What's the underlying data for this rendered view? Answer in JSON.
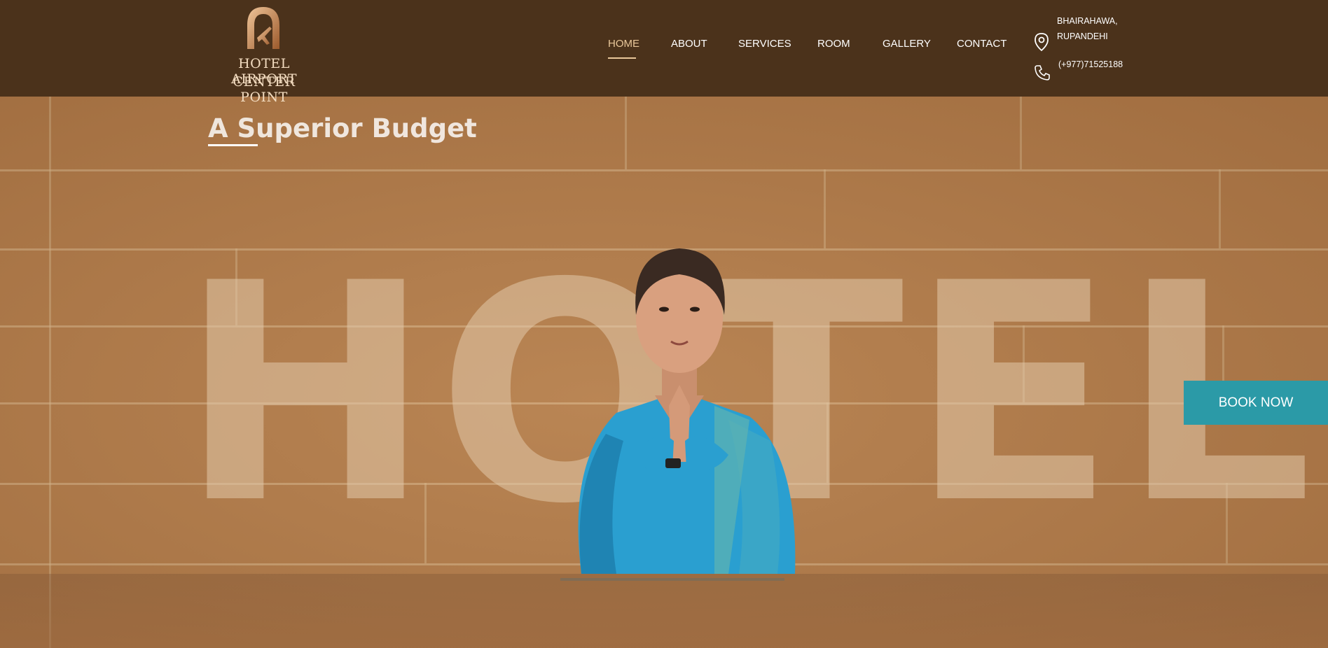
{
  "brand": {
    "name_line1": "HOTEL AIRPORT",
    "name_line2": "CENTER POINT",
    "logo_icon": "airplane-arch-logo",
    "accent_color": "#e9c79a"
  },
  "nav": {
    "items": [
      {
        "label": "HOME",
        "active": true
      },
      {
        "label": "ABOUT",
        "active": false
      },
      {
        "label": "SERVICES",
        "active": false
      },
      {
        "label": "ROOM",
        "active": false
      },
      {
        "label": "GALLERY",
        "active": false
      },
      {
        "label": "CONTACT",
        "active": false
      }
    ]
  },
  "contact": {
    "address_line1": "BHAIRAHAWA,",
    "address_line2": "RUPANDEHI",
    "phone": "(+977)71525188",
    "address_icon": "map-pin-icon",
    "phone_icon": "phone-icon"
  },
  "hero": {
    "headline": "A Superior Budget",
    "watermark": "HOTEL"
  },
  "cta": {
    "book_now": "BOOK NOW",
    "color": "#2b9aa7"
  }
}
